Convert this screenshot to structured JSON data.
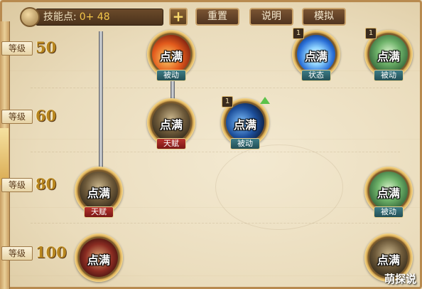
{
  "header": {
    "points_label": "技能点:",
    "points_value": "0+ 48",
    "plus_label": "+",
    "buttons": [
      "重置",
      "说明",
      "模拟"
    ]
  },
  "levels": [
    {
      "tag": "等级",
      "num": "50"
    },
    {
      "tag": "等级",
      "num": "60"
    },
    {
      "tag": "等级",
      "num": "80"
    },
    {
      "tag": "等级",
      "num": "100"
    }
  ],
  "skills": [
    {
      "label": "点满",
      "type": "被动",
      "kind": "passive",
      "icon": "fire-skill-icon"
    },
    {
      "label": "点满",
      "type": "状态",
      "kind": "passive",
      "icon": "blue-burst-skill-icon",
      "badge": "1"
    },
    {
      "label": "点满",
      "type": "被动",
      "kind": "passive",
      "icon": "green-gate-skill-icon",
      "badge": "1"
    },
    {
      "label": "点满",
      "type": "天赋",
      "kind": "talent",
      "icon": "dark-figure-skill-icon"
    },
    {
      "label": "点满",
      "type": "被动",
      "kind": "passive",
      "icon": "blue-shadow-skill-icon",
      "badge": "1"
    },
    {
      "label": "点满",
      "type": "天赋",
      "kind": "talent",
      "icon": "dark-warrior-skill-icon"
    },
    {
      "label": "点满",
      "type": "被动",
      "kind": "passive",
      "icon": "green-gate-skill-icon"
    },
    {
      "label": "点满",
      "type": "",
      "kind": "none",
      "icon": "red-figure-skill-icon"
    },
    {
      "label": "点满",
      "type": "",
      "kind": "none",
      "icon": "dark-figure-skill-icon"
    }
  ],
  "watermark": "萌探说",
  "colors": {
    "level_number": "#b8861e",
    "passive_tag": "#2f6a72",
    "talent_tag": "#9a2420"
  }
}
